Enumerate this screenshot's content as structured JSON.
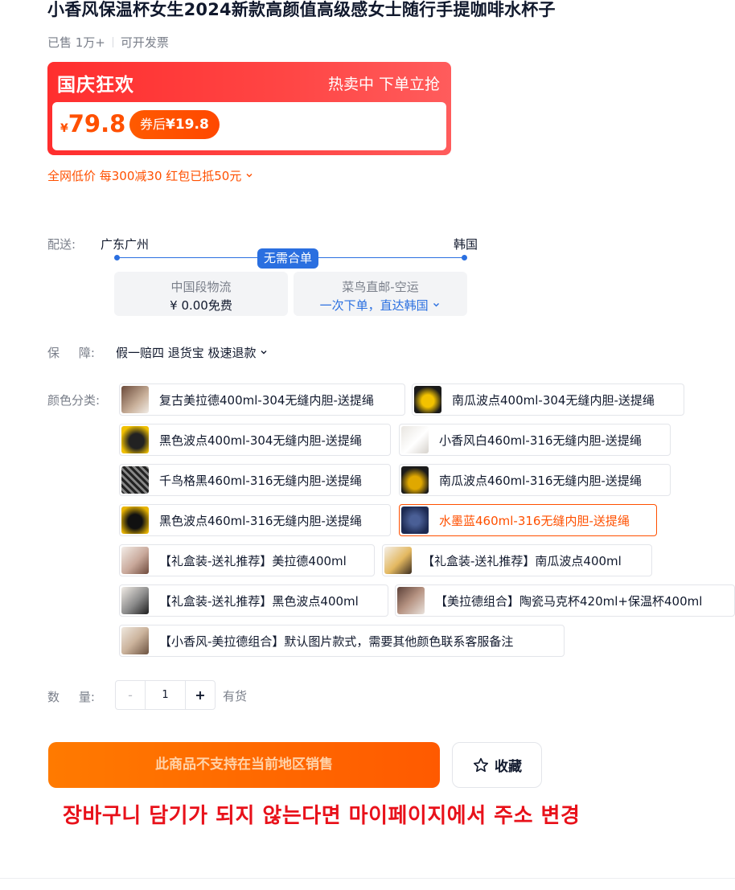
{
  "product": {
    "title": "小香风保温杯女生2024新款高颜值高级感女士随行手提咖啡水杯子",
    "sold": "已售 1万+",
    "invoice": "可开发票"
  },
  "promo": {
    "name": "国庆狂欢",
    "tagline": "热卖中 下单立抢",
    "currency": "¥",
    "price": "79.8",
    "coupon_label": "券后",
    "coupon_price": "¥19.8",
    "discount_line": "全网低价 每300减30 红包已抵50元",
    "accent_color": "#ff5000",
    "banner_color": "#ff3333"
  },
  "shipping": {
    "label": "配送:",
    "from": "广东广州",
    "to": "韩国",
    "badge": "无需合单",
    "option1_title": "中国段物流",
    "option1_value": "¥ 0.00免费",
    "option2_title": "菜鸟直邮-空运",
    "option2_value": "一次下单，直达韩国"
  },
  "guarantee": {
    "label": "保     障:",
    "text": "假一赔四 退货宝 极速退款"
  },
  "colors": {
    "label": "颜色分类:",
    "selected_index": 7,
    "options": [
      {
        "label": "复古美拉德400ml-304无缝内胆-送提绳"
      },
      {
        "label": "南瓜波点400ml-304无缝内胆-送提绳"
      },
      {
        "label": "黑色波点400ml-304无缝内胆-送提绳"
      },
      {
        "label": "小香风白460ml-316无缝内胆-送提绳"
      },
      {
        "label": "千鸟格黑460ml-316无缝内胆-送提绳"
      },
      {
        "label": "南瓜波点460ml-316无缝内胆-送提绳"
      },
      {
        "label": "黑色波点460ml-316无缝内胆-送提绳"
      },
      {
        "label": "水墨蓝460ml-316无缝内胆-送提绳"
      },
      {
        "label": "【礼盒装-送礼推荐】美拉德400ml"
      },
      {
        "label": "【礼盒装-送礼推荐】南瓜波点400ml"
      },
      {
        "label": "【礼盒装-送礼推荐】黑色波点400ml"
      },
      {
        "label": "【美拉德组合】陶瓷马克杯420ml+保温杯400ml"
      },
      {
        "label": "【小香风-美拉德组合】默认图片款式，需要其他颜色联系客服备注"
      }
    ]
  },
  "quantity": {
    "label": "数     量:",
    "minus": "-",
    "value": "1",
    "plus": "+",
    "stock": "有货"
  },
  "actions": {
    "buy_label": "此商品不支持在当前地区销售",
    "fav_label": "收藏"
  },
  "notice": "장바구니 담기가 되지 않는다면 마이페이지에서 주소 변경"
}
